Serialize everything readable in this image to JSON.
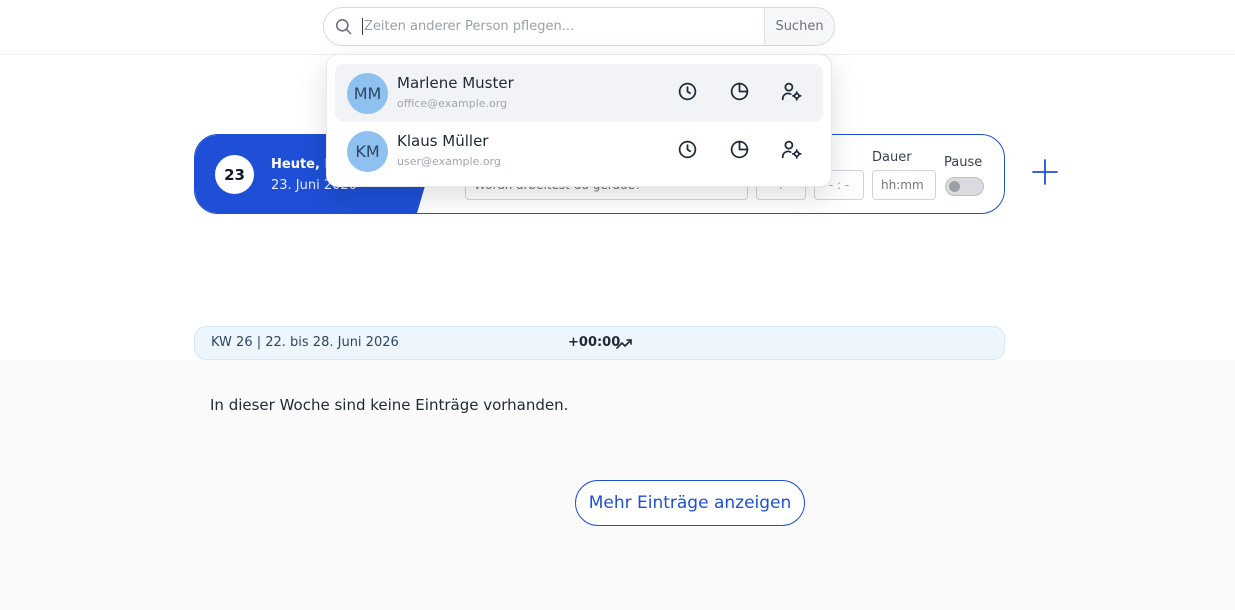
{
  "search": {
    "placeholder": "Zeiten anderer Person pflegen...",
    "button_label": "Suchen"
  },
  "users": [
    {
      "initials": "MM",
      "name": "Marlene Muster",
      "email": "office@example.org"
    },
    {
      "initials": "KM",
      "name": "Klaus Müller",
      "email": "user@example.org"
    }
  ],
  "today": {
    "day_number": "23",
    "label": "Heute, D",
    "date": "23. Juni 2026",
    "description_placeholder": "Woran arbeitest du gerade?",
    "start_value": "- : -",
    "end_value": "- : -",
    "duration_label": "Dauer",
    "duration_placeholder": "hh:mm",
    "pause_label": "Pause"
  },
  "week": {
    "label": "KW 26 | 22. bis 28. Juni 2026",
    "total": "+00:00"
  },
  "empty_message": "In dieser Woche sind keine Einträge vorhanden.",
  "more_button_label": "Mehr Einträge anzeigen",
  "colors": {
    "accent": "#1e4fd6",
    "avatar": "#8ec0f0",
    "week_bar": "#eef6fd"
  }
}
